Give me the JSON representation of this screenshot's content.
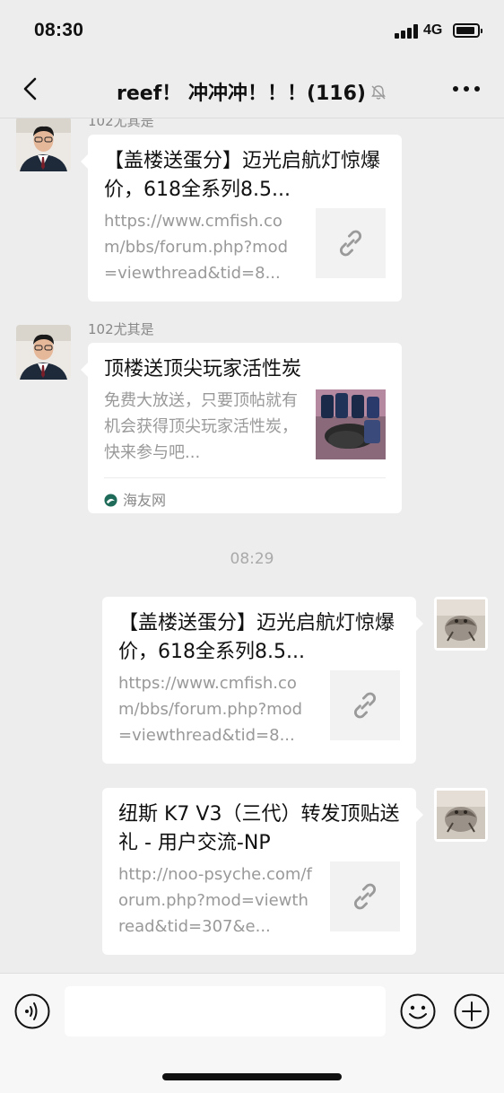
{
  "status_bar": {
    "time": "08:30",
    "network": "4G"
  },
  "nav": {
    "title": "reef！ 冲冲冲！！！(116)"
  },
  "messages": [
    {
      "sender": "102尤其是",
      "title": "【盖楼送蛋分】迈光启航灯惊爆价，618全系列8.5...",
      "desc": "https://www.cmfish.com/bbs/forum.php?mod=viewthread&tid=8...",
      "thumb": "link-icon"
    },
    {
      "sender": "102尤其是",
      "title": "顶楼送顶尖玩家活性炭",
      "desc": "免费大放送，只要顶帖就有机会获得顶尖玩家活性炭，快来参与吧...",
      "thumb": "product-photo",
      "source": "海友网"
    },
    {
      "title": "【盖楼送蛋分】迈光启航灯惊爆价，618全系列8.5...",
      "desc": "https://www.cmfish.com/bbs/forum.php?mod=viewthread&tid=8...",
      "thumb": "link-icon"
    },
    {
      "title": "纽斯 K7 V3（三代）转发顶贴送礼 - 用户交流-NP",
      "desc": "http://noo-psyche.com/forum.php?mod=viewthread&tid=307&e...",
      "thumb": "link-icon"
    }
  ],
  "timestamp": "08:29",
  "input": {
    "placeholder": ""
  },
  "colors": {
    "background": "#ededed",
    "card": "#ffffff",
    "muted_text": "#999999",
    "source_icon": "#1f6b5a"
  }
}
